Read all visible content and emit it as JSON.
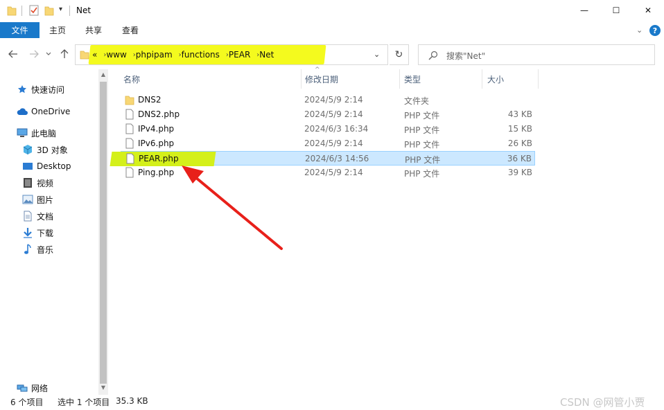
{
  "window": {
    "title": "Net",
    "minimize_glyph": "—",
    "maximize_glyph": "☐",
    "close_glyph": "✕"
  },
  "ribbon": {
    "file_tab": "文件",
    "tabs": [
      "主页",
      "共享",
      "查看"
    ]
  },
  "address": {
    "crumbs": [
      "«",
      "www",
      "phpipam",
      "functions",
      "PEAR",
      "Net"
    ],
    "highlight_color": "#f4fa1e"
  },
  "search": {
    "placeholder": "搜索\"Net\""
  },
  "sidebar": {
    "items": [
      {
        "label": "快速访问",
        "icon": "star-icon"
      },
      {
        "label": "OneDrive",
        "icon": "cloud-icon"
      },
      {
        "label": "此电脑",
        "icon": "computer-icon"
      },
      {
        "label": "3D 对象",
        "icon": "cube-icon"
      },
      {
        "label": "Desktop",
        "icon": "desktop-icon"
      },
      {
        "label": "视频",
        "icon": "video-icon"
      },
      {
        "label": "图片",
        "icon": "picture-icon"
      },
      {
        "label": "文档",
        "icon": "document-icon"
      },
      {
        "label": "下载",
        "icon": "download-icon"
      },
      {
        "label": "音乐",
        "icon": "music-icon"
      },
      {
        "label": "网络",
        "icon": "network-icon"
      }
    ]
  },
  "columns": {
    "name": "名称",
    "date": "修改日期",
    "type": "类型",
    "size": "大小"
  },
  "files": [
    {
      "name": "DNS2",
      "date": "2024/5/9 2:14",
      "type": "文件夹",
      "size": "",
      "kind": "folder"
    },
    {
      "name": "DNS2.php",
      "date": "2024/5/9 2:14",
      "type": "PHP 文件",
      "size": "43 KB",
      "kind": "file"
    },
    {
      "name": "IPv4.php",
      "date": "2024/6/3 16:34",
      "type": "PHP 文件",
      "size": "15 KB",
      "kind": "file"
    },
    {
      "name": "IPv6.php",
      "date": "2024/5/9 2:14",
      "type": "PHP 文件",
      "size": "26 KB",
      "kind": "file"
    },
    {
      "name": "PEAR.php",
      "date": "2024/6/3 14:56",
      "type": "PHP 文件",
      "size": "36 KB",
      "kind": "file",
      "selected": true
    },
    {
      "name": "Ping.php",
      "date": "2024/5/9 2:14",
      "type": "PHP 文件",
      "size": "39 KB",
      "kind": "file"
    }
  ],
  "status": {
    "count": "6 个项目",
    "selected": "选中 1 个项目",
    "size": "35.3 KB"
  },
  "watermark": "CSDN @网管小贾",
  "colors": {
    "accent": "#1979ca",
    "selection": "#cce8ff",
    "name_highlight": "#d4f01a",
    "arrow": "#e8201a"
  }
}
